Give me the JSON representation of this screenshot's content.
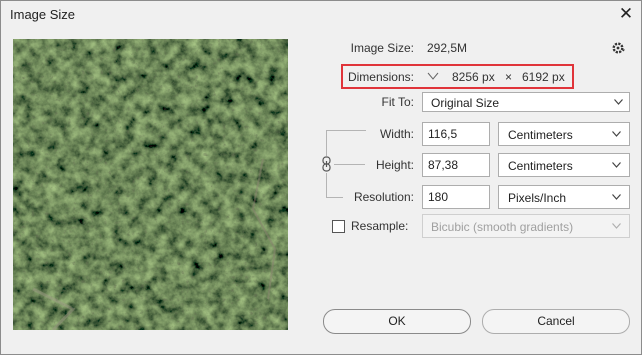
{
  "window": {
    "title": "Image Size",
    "close_symbol": "✕"
  },
  "info": {
    "image_size_label": "Image Size:",
    "image_size_value": "292,5M",
    "dimensions_label": "Dimensions:",
    "width_px": "8256 px",
    "times": "×",
    "height_px": "6192 px"
  },
  "fit_to": {
    "label": "Fit To:",
    "value": "Original Size"
  },
  "width": {
    "label": "Width:",
    "value": "116,5",
    "unit": "Centimeters"
  },
  "height": {
    "label": "Height:",
    "value": "87,38",
    "unit": "Centimeters"
  },
  "resolution": {
    "label": "Resolution:",
    "value": "180",
    "unit": "Pixels/Inch"
  },
  "resample": {
    "label": "Resample:",
    "checked": false,
    "method": "Bicubic (smooth gradients)"
  },
  "buttons": {
    "ok": "OK",
    "cancel": "Cancel"
  },
  "icons": {
    "gear": "gear-icon",
    "chain": "chain-link-icon",
    "chevron": "chevron-down-icon",
    "close": "close-icon"
  },
  "colors": {
    "highlight": "#e0343a",
    "dialog_bg": "#f0f0f0"
  }
}
